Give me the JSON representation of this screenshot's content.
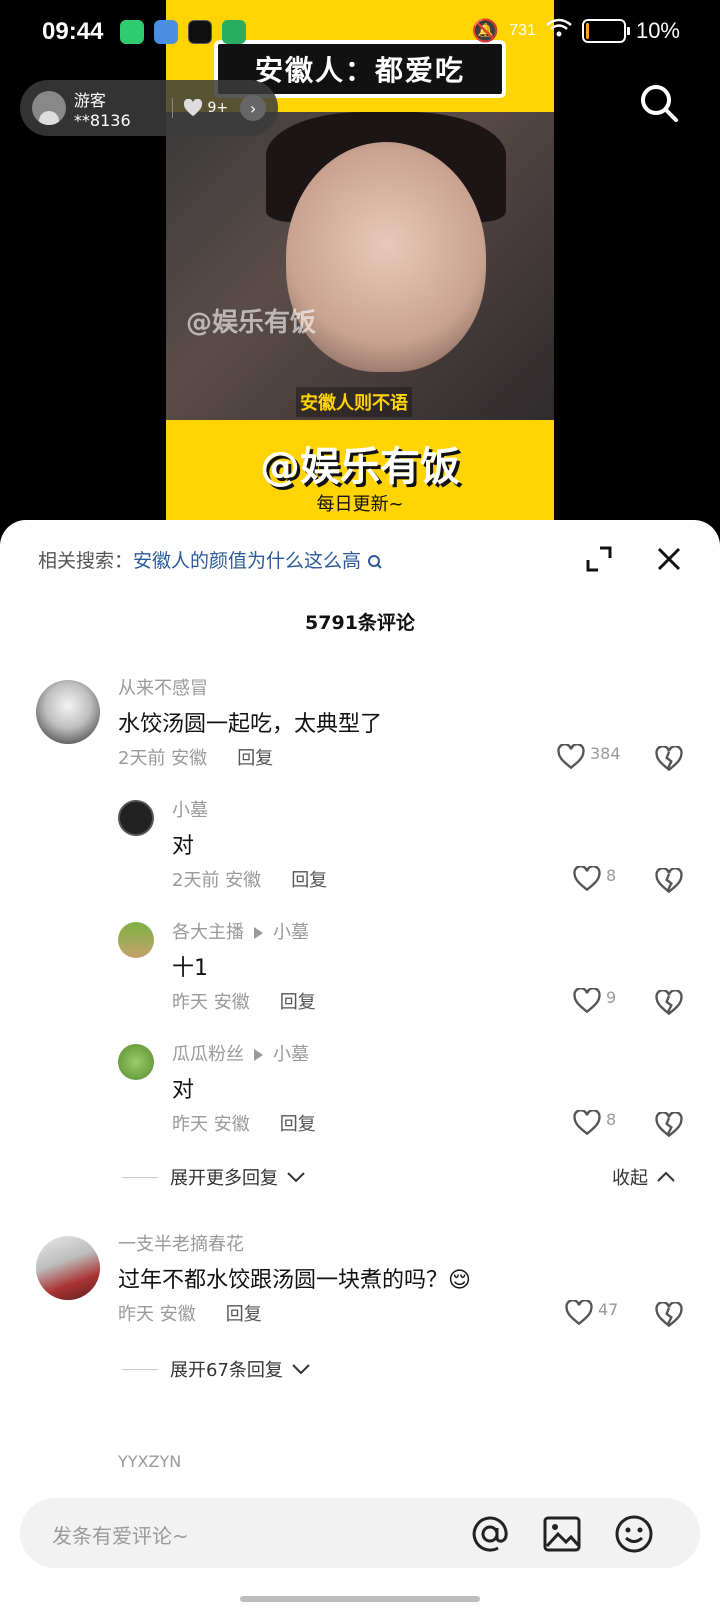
{
  "status_bar": {
    "time": "09:44",
    "network_speed": "731",
    "battery": "10%",
    "battery_color": "#f5a623"
  },
  "video": {
    "title": "安徽人：都爱吃",
    "watermark": "@娱乐有饭",
    "subtitle": "安徽人则不语",
    "brand": "@娱乐有饭",
    "daily": "每日更新~"
  },
  "top_user": {
    "name": "游客**8136",
    "likes": "9+"
  },
  "sheet": {
    "related_prefix": "相关搜索：",
    "related_query": "安徽人的颜值为什么这么高",
    "comment_count": "5791条评论"
  },
  "comments": [
    {
      "author": "从来不感冒",
      "text": "水饺汤圆一起吃，太典型了",
      "time_loc": "2天前 安徽",
      "reply_label": "回复",
      "likes": "384",
      "replies": [
        {
          "author": "小墓",
          "reply_to": "",
          "text": "对",
          "time_loc": "2天前 安徽",
          "reply_label": "回复",
          "likes": "8"
        },
        {
          "author": "各大主播",
          "reply_to": "小墓",
          "text": "十1",
          "time_loc": "昨天 安徽",
          "reply_label": "回复",
          "likes": "9"
        },
        {
          "author": "瓜瓜粉丝",
          "reply_to": "小墓",
          "text": "对",
          "time_loc": "昨天 安徽",
          "reply_label": "回复",
          "likes": "8"
        }
      ],
      "expand_more": "展开更多回复",
      "collapse": "收起"
    },
    {
      "author": "一支半老摘春花",
      "text": "过年不都水饺跟汤圆一块煮的吗？😌",
      "time_loc": "昨天 安徽",
      "reply_label": "回复",
      "likes": "47",
      "expand_more": "展开67条回复"
    },
    {
      "author": "YYXZYN"
    }
  ],
  "input": {
    "placeholder": "发条有爱评论~"
  }
}
